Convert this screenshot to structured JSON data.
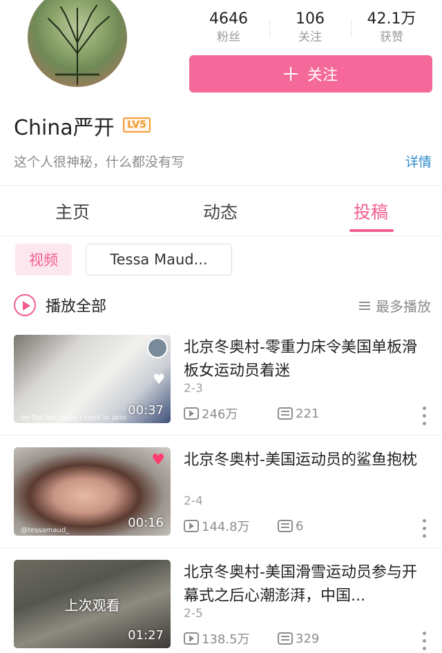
{
  "profile": {
    "username": "China严开",
    "level": "LV5",
    "bio": "这个人很神秘，什么都没有写",
    "detail_label": "详情",
    "follow_label": "关注",
    "stats": [
      {
        "value": "4646",
        "label": "粉丝"
      },
      {
        "value": "106",
        "label": "关注"
      },
      {
        "value": "42.1万",
        "label": "获赞"
      }
    ]
  },
  "tabs": [
    {
      "label": "主页",
      "active": false
    },
    {
      "label": "动态",
      "active": false
    },
    {
      "label": "投稿",
      "active": true
    }
  ],
  "filters": {
    "type_chip": "视频",
    "collection_chip": "Tessa Maud..."
  },
  "list_header": {
    "play_all": "播放全部",
    "sort": "最多播放"
  },
  "videos": [
    {
      "title": "北京冬奥村-零重力床令美国单板滑板女运动员着迷",
      "episode": "2-3",
      "plays": "246万",
      "danmaku": "221",
      "duration": "00:37",
      "caption": "be flat last night I slept in zero"
    },
    {
      "title": "北京冬奥村-美国运动员的鲨鱼抱枕",
      "episode": "2-4",
      "plays": "144.8万",
      "danmaku": "6",
      "duration": "00:16",
      "caption": "@tessamaud_"
    },
    {
      "title": "北京冬奥村-美国滑雪运动员参与开幕式之后心潮澎湃，中国...",
      "episode": "2-5",
      "plays": "138.5万",
      "danmaku": "329",
      "duration": "01:27",
      "overlay": "上次观看"
    }
  ],
  "colors": {
    "accent_pink": "#f25d8e",
    "follow_button": "#f4699a",
    "link_blue": "#2e89c9",
    "level_orange": "#f59a32"
  }
}
